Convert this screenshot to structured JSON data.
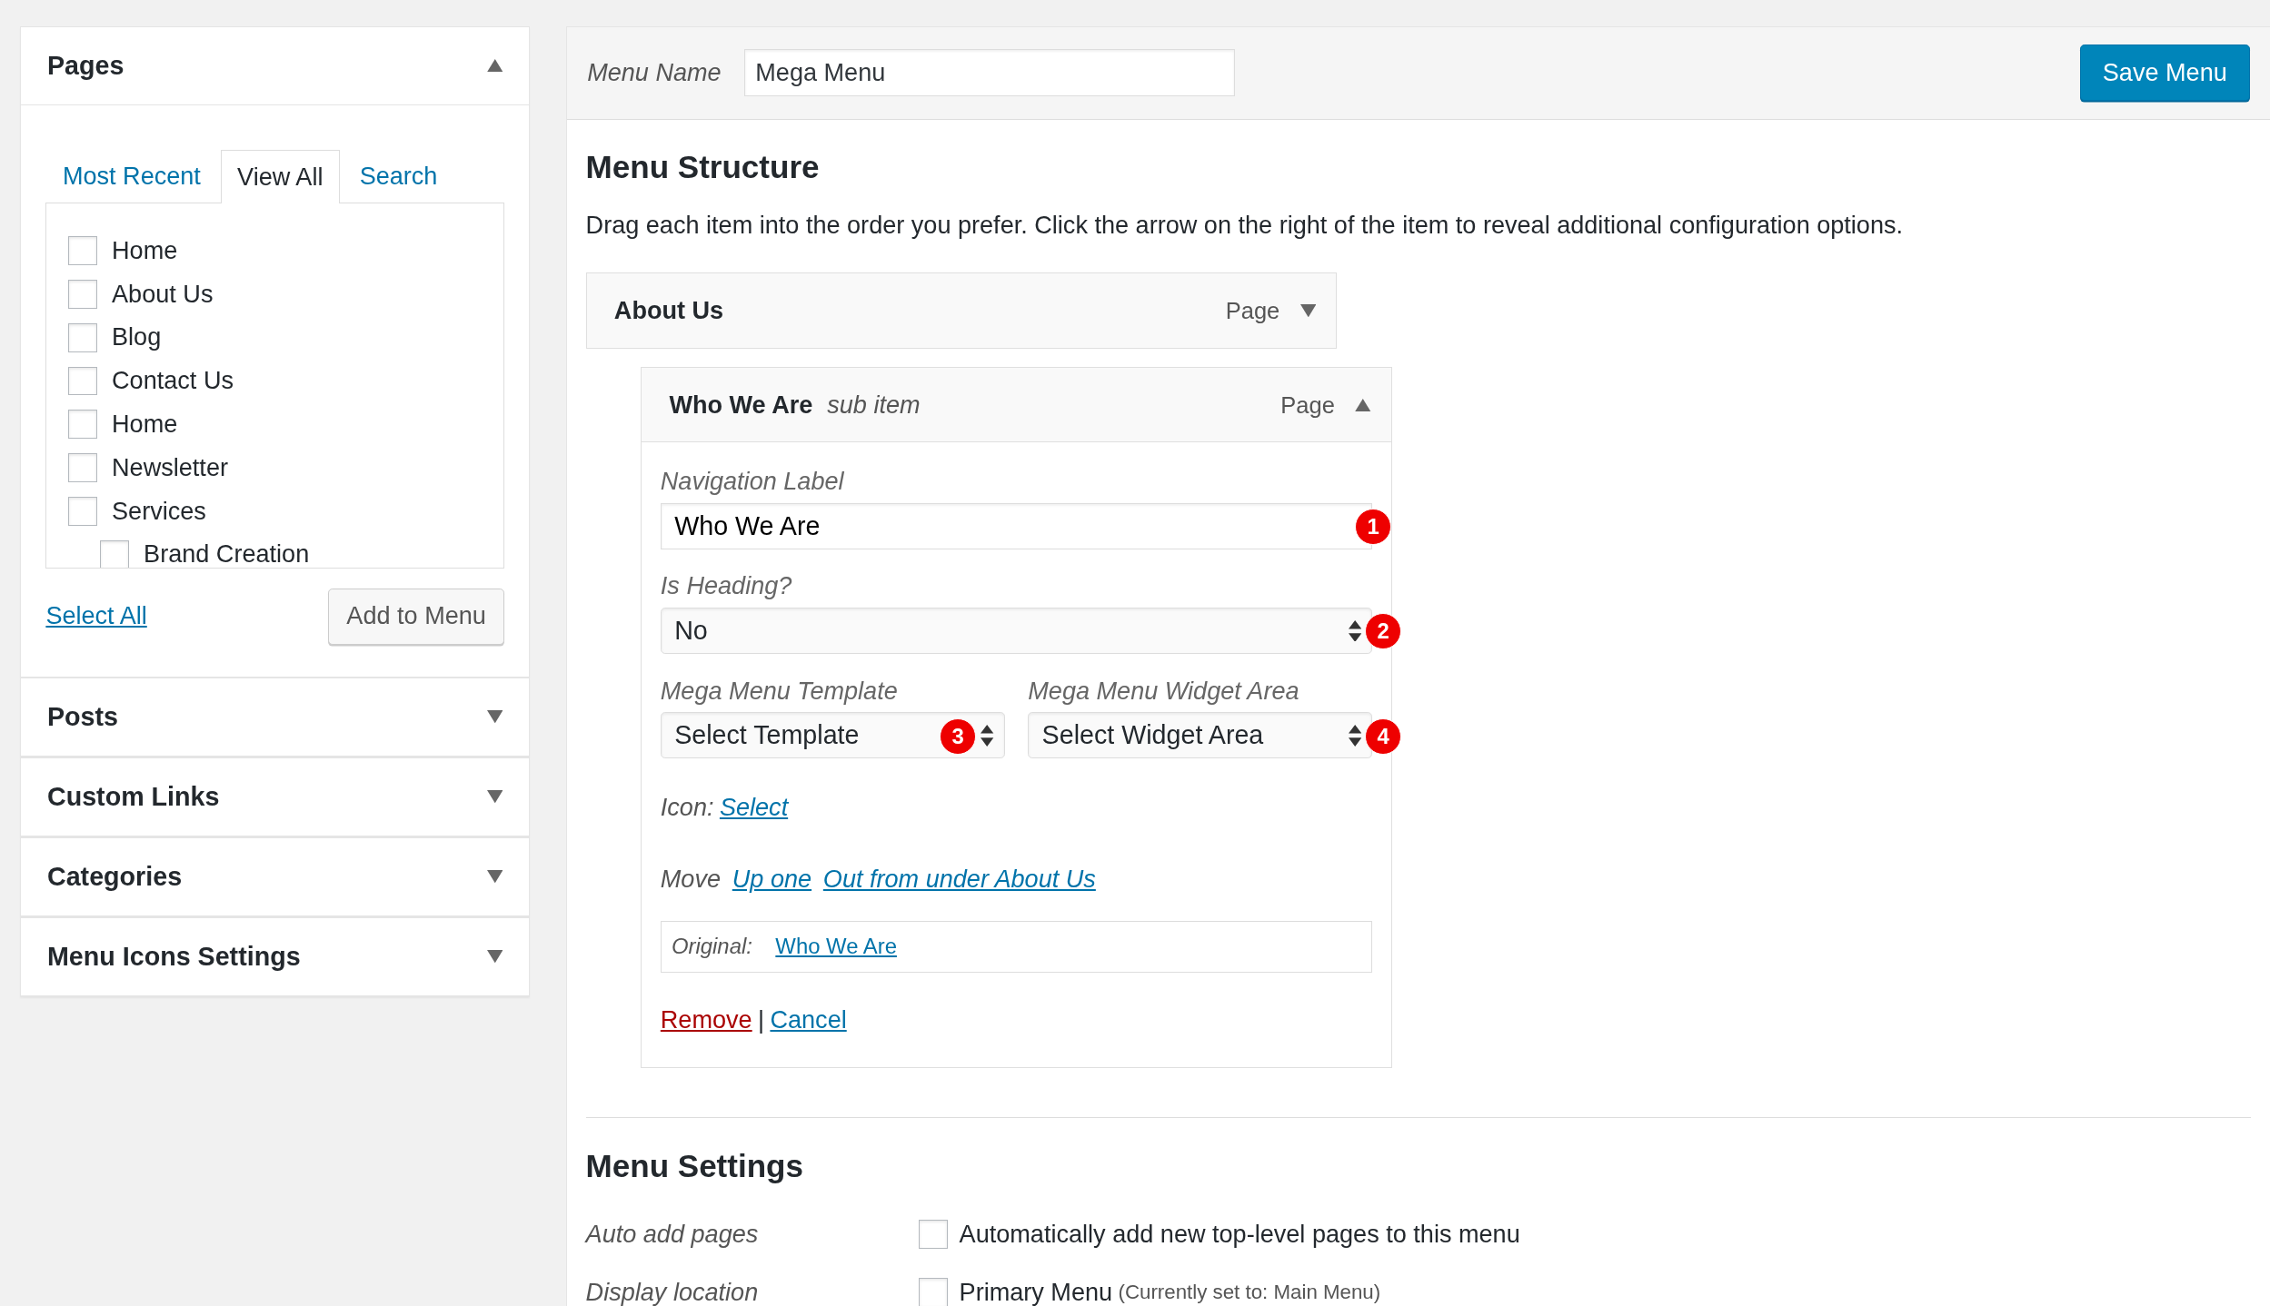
{
  "sidebar": {
    "sections": [
      {
        "title": "Pages",
        "expanded": true,
        "tabs": [
          {
            "label": "Most Recent",
            "selected": false
          },
          {
            "label": "View All",
            "selected": true
          },
          {
            "label": "Search",
            "selected": false
          }
        ],
        "items": [
          {
            "label": "Home",
            "checked": false
          },
          {
            "label": "About Us",
            "checked": false
          },
          {
            "label": "Blog",
            "checked": false
          },
          {
            "label": "Contact Us",
            "checked": false
          },
          {
            "label": "Home",
            "checked": false
          },
          {
            "label": "Newsletter",
            "checked": false
          },
          {
            "label": "Services",
            "checked": false,
            "children": [
              {
                "label": "Brand Creation",
                "checked": false
              }
            ]
          }
        ],
        "select_all": "Select All",
        "add_button": "Add to Menu"
      },
      {
        "title": "Posts",
        "expanded": false
      },
      {
        "title": "Custom Links",
        "expanded": false
      },
      {
        "title": "Categories",
        "expanded": false
      },
      {
        "title": "Menu Icons Settings",
        "expanded": false
      }
    ]
  },
  "menu_name": {
    "label": "Menu Name",
    "value": "Mega Menu"
  },
  "save_button": "Save Menu",
  "structure": {
    "title": "Menu Structure",
    "description": "Drag each item into the order you prefer. Click the arrow on the right of the item to reveal additional configuration options.",
    "items": [
      {
        "title": "About Us",
        "type": "Page",
        "expanded": false,
        "children": [
          {
            "title": "Who We Are",
            "subtitle": "sub item",
            "type": "Page",
            "expanded": true,
            "fields": [
              {
                "kind": "text",
                "label": "Navigation Label",
                "value": "Who We Are",
                "marker": "1"
              },
              {
                "kind": "select",
                "label": "Is Heading?",
                "value": "No",
                "marker": "2"
              }
            ],
            "pair": [
              {
                "kind": "select",
                "label": "Mega Menu Template",
                "value": "Select Template",
                "marker": "3"
              },
              {
                "kind": "select",
                "label": "Mega Menu Widget Area",
                "value": "Select Widget Area",
                "marker": "4"
              }
            ],
            "icon": {
              "label": "Icon:",
              "link": "Select"
            },
            "move": {
              "label": "Move",
              "links": [
                "Up one",
                "Out from under About Us"
              ]
            },
            "original": {
              "label": "Original:",
              "link": "Who We Are"
            },
            "remove": "Remove",
            "separator": "|",
            "cancel": "Cancel"
          }
        ]
      }
    ]
  },
  "settings": {
    "title": "Menu Settings",
    "rows": [
      {
        "label": "Auto add pages",
        "option": "Automatically add new top-level pages to this menu",
        "checked": false
      },
      {
        "label": "Display location",
        "option": "Primary Menu",
        "note": "(Currently set to: Main Menu)",
        "checked": false
      }
    ]
  }
}
